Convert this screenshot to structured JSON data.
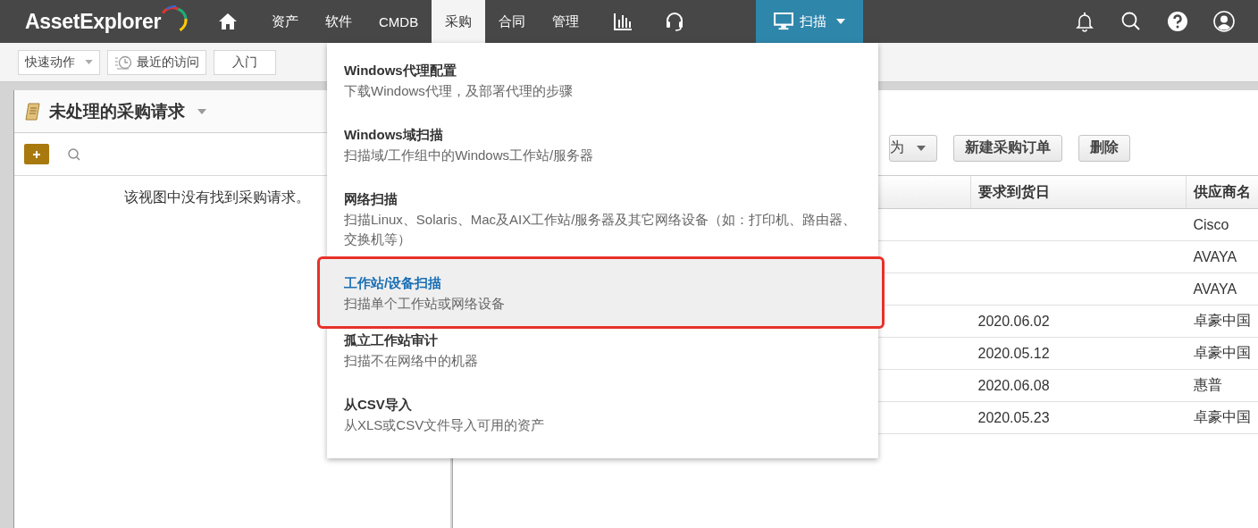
{
  "nav": {
    "logo": "AssetExplorer",
    "tabs": [
      {
        "label": "资产",
        "selected": false
      },
      {
        "label": "软件",
        "selected": false
      },
      {
        "label": "CMDB",
        "selected": false
      },
      {
        "label": "采购",
        "selected": true
      },
      {
        "label": "合同",
        "selected": false
      },
      {
        "label": "管理",
        "selected": false
      }
    ],
    "scan_button": {
      "label": "扫描"
    }
  },
  "toolbar": {
    "quick_actions": "快速动作",
    "recent": "最近的访问",
    "getting_started": "入门"
  },
  "scan_menu": {
    "items": [
      {
        "title": "Windows代理配置",
        "description": "下载Windows代理，及部署代理的步骤",
        "selected": false
      },
      {
        "title": "Windows域扫描",
        "description": "扫描域/工作组中的Windows工作站/服务器",
        "selected": false
      },
      {
        "title": "网络扫描",
        "description": "扫描Linux、Solaris、Mac及AIX工作站/服务器及其它网络设备（如：打印机、路由器、交换机等）",
        "selected": false
      },
      {
        "title": "工作站/设备扫描",
        "description": "扫描单个工作站或网络设备",
        "selected": true
      },
      {
        "title": "孤立工作站审计",
        "description": "扫描不在网络中的机器",
        "selected": false
      },
      {
        "title": "从CSV导入",
        "description": "从XLS或CSV文件导入可用的资产",
        "selected": false
      }
    ]
  },
  "left_panel": {
    "title": "未处理的采购请求",
    "empty_message": "该视图中没有找到采购请求。"
  },
  "right_panel": {
    "buttons": [
      {
        "label": "为",
        "kind": "dropdown"
      },
      {
        "label": "新建采购订单",
        "kind": "plain"
      },
      {
        "label": "删除",
        "kind": "plain"
      }
    ],
    "table": {
      "columns": [
        "要求到货日",
        "供应商名"
      ],
      "rows": [
        {
          "vendor": "Cisco"
        },
        {
          "vendor": "AVAYA"
        },
        {
          "vendor": "AVAYA"
        },
        {
          "due_date": "2020.06.02",
          "vendor": "卓豪中国"
        },
        {
          "due_date": "2020.05.12",
          "vendor": "卓豪中国"
        },
        {
          "due_date": "2020.06.08",
          "vendor": "惠普"
        },
        {
          "due_date": "2020.05.23",
          "vendor": "卓豪中国"
        }
      ]
    }
  }
}
